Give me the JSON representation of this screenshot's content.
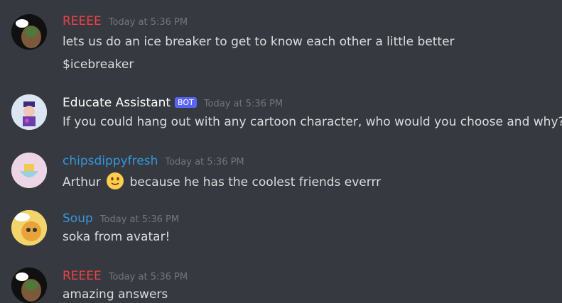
{
  "messages": [
    {
      "username": "REEEE",
      "username_color": "#ed4245",
      "timestamp": "Today at 5:36 PM",
      "lines": [
        "lets us do an ice breaker to get to know each other a little better",
        "$icebreaker"
      ]
    },
    {
      "username": "Educate Assistant",
      "username_color": "#ffffff",
      "bot_badge": "BOT",
      "timestamp": "Today at 5:36 PM",
      "lines": [
        "If you could hang out with any cartoon character, who would you choose and why?"
      ]
    },
    {
      "username": "chipsdippyfresh",
      "username_color": "#3498db",
      "timestamp": "Today at 5:36 PM",
      "line_before_emoji": "Arthur",
      "emoji": "slightly-smiling-face-emoji",
      "line_after_emoji": "because he has the coolest friends everrr"
    },
    {
      "username": "Soup",
      "username_color": "#3498db",
      "timestamp": "Today at 5:36 PM",
      "lines": [
        "soka from avatar!"
      ]
    },
    {
      "username": "REEEE",
      "username_color": "#ed4245",
      "timestamp": "Today at 5:36 PM",
      "lines": [
        "amazing answers"
      ]
    }
  ]
}
